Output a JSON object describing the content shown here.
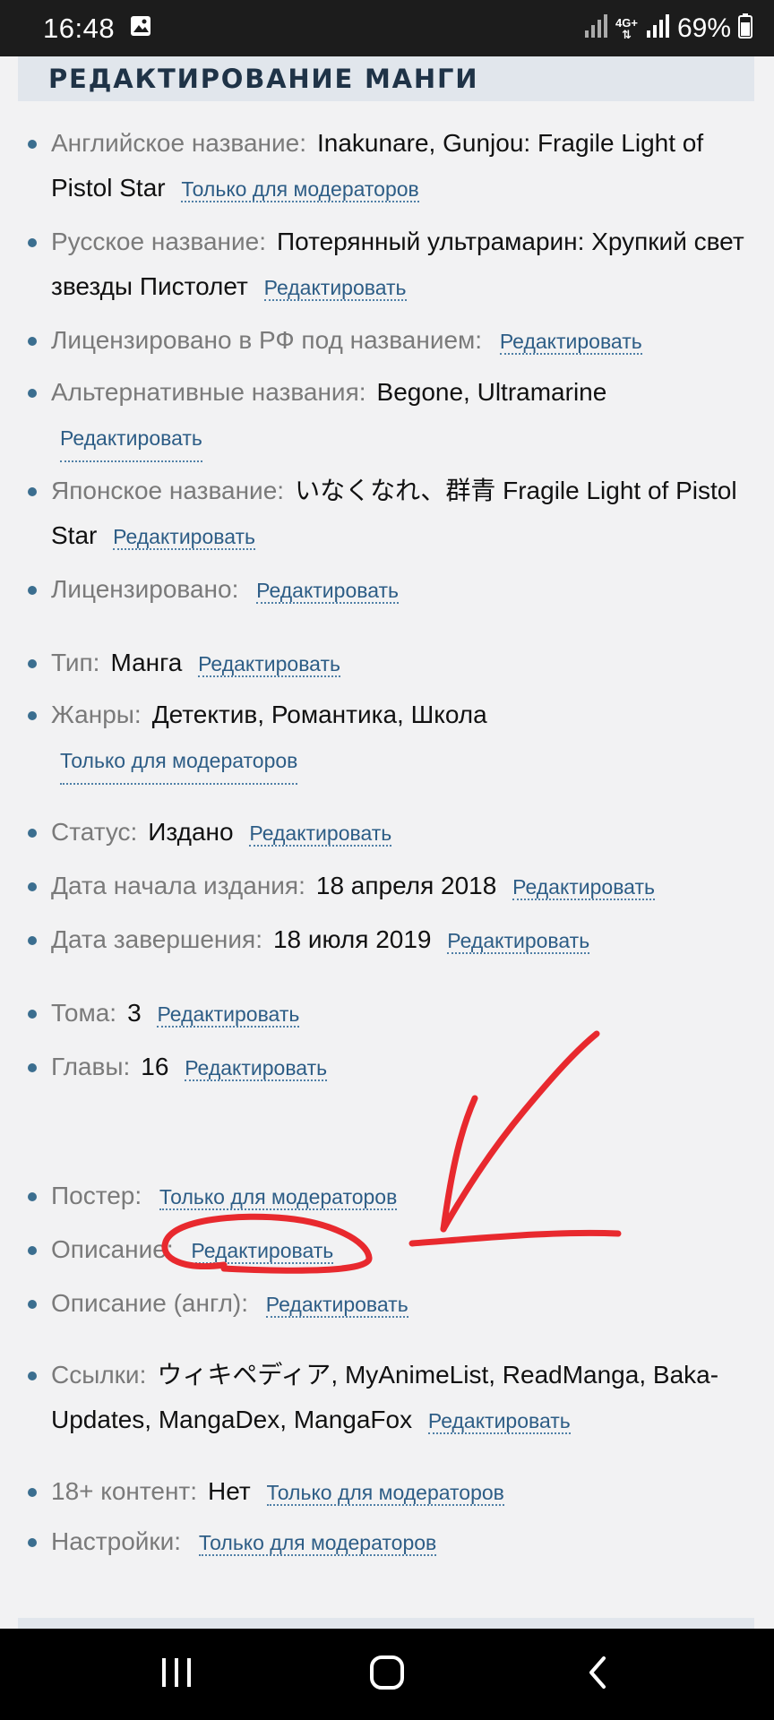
{
  "status_bar": {
    "time": "16:48",
    "network": "4G+",
    "battery": "69%"
  },
  "page": {
    "title": "РЕДАКТИРОВАНИЕ МАНГИ"
  },
  "fields": [
    {
      "label": "Английское название:",
      "value": "Inakunare, Gunjou: Fragile Light of Pistol Star",
      "link": "Только для модераторов"
    },
    {
      "label": "Русское название:",
      "value": "Потерянный ультрамарин: Хрупкий свет звезды Пистолет",
      "link": "Редактировать"
    },
    {
      "label": "Лицензировано в РФ под названием:",
      "value": "",
      "link": "Редактировать"
    },
    {
      "label": "Альтернативные названия:",
      "value": "Begone, Ultramarine",
      "link": "Редактировать"
    },
    {
      "label": "Японское название:",
      "value": "いなくなれ、群青 Fragile Light of Pistol Star",
      "link": "Редактировать"
    },
    {
      "label": "Лицензировано:",
      "value": "",
      "link": "Редактировать"
    },
    {
      "label": "Тип:",
      "value": "Манга",
      "link": "Редактировать"
    },
    {
      "label": "Жанры:",
      "value": "Детектив, Романтика, Школа",
      "link": "Только для модераторов"
    },
    {
      "label": "Статус:",
      "value": "Издано",
      "link": "Редактировать"
    },
    {
      "label": "Дата начала издания:",
      "value": "18 апреля 2018",
      "link": "Редактировать"
    },
    {
      "label": "Дата завершения:",
      "value": "18 июля 2019",
      "link": "Редактировать"
    },
    {
      "label": "Тома:",
      "value": "3",
      "link": "Редактировать"
    },
    {
      "label": "Главы:",
      "value": "16",
      "link": "Редактировать"
    },
    {
      "label": "Постер:",
      "value": "",
      "link": "Только для модераторов"
    },
    {
      "label": "Описание:",
      "value": "",
      "link": "Редактировать"
    },
    {
      "label": "Описание (англ):",
      "value": "",
      "link": "Редактировать"
    },
    {
      "label": "Ссылки:",
      "value": "ウィキペディア, MyAnimeList, ReadManga, Baka-Updates, MangaDex, MangaFox",
      "link": "Редактировать"
    },
    {
      "label": "18+ контент:",
      "value": "Нет",
      "link": "Только для модераторов"
    },
    {
      "label": "Настройки:",
      "value": "",
      "link": "Только для модераторов"
    }
  ],
  "colors": {
    "accent_link": "#2d5d86",
    "annotation": "#e8292e"
  },
  "nav": {
    "recents_icon": "recent-apps-icon",
    "home_icon": "home-icon",
    "back_icon": "back-icon"
  }
}
